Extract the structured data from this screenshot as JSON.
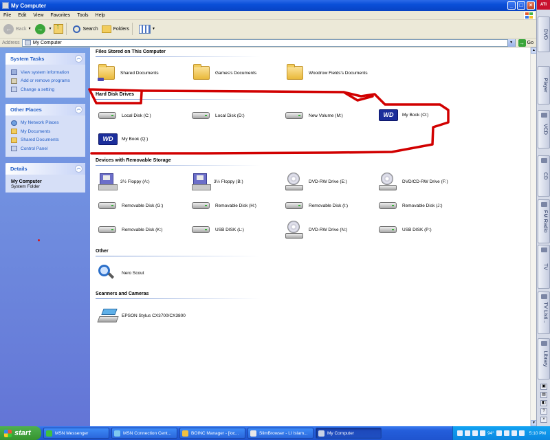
{
  "window": {
    "title": "My Computer"
  },
  "menu": [
    "File",
    "Edit",
    "View",
    "Favorites",
    "Tools",
    "Help"
  ],
  "toolbar": {
    "back": "Back",
    "search": "Search",
    "folders": "Folders"
  },
  "address": {
    "label": "Address",
    "value": "My Computer",
    "go": "Go"
  },
  "left": {
    "system_tasks": {
      "title": "System Tasks",
      "items": [
        "View system information",
        "Add or remove programs",
        "Change a setting"
      ]
    },
    "other_places": {
      "title": "Other Places",
      "items": [
        "My Network Places",
        "My Documents",
        "Shared Documents",
        "Control Panel"
      ]
    },
    "details": {
      "title": "Details",
      "name": "My Computer",
      "type": "System Folder"
    }
  },
  "groups": {
    "files": {
      "title": "Files Stored on This Computer",
      "items": [
        "Shared Documents",
        "Games's Documents",
        "Woodrow Fields's Documents"
      ]
    },
    "hdd": {
      "title": "Hard Disk Drives",
      "items": [
        "Local Disk (C:)",
        "Local Disk (D:)",
        "New Volume (M:)",
        "My Book (O:)",
        "My Book (Q:)"
      ]
    },
    "removable": {
      "title": "Devices with Removable Storage",
      "items": [
        "3½ Floppy (A:)",
        "3½ Floppy (B:)",
        "DVD-RW Drive (E:)",
        "DVD/CD-RW Drive (F:)",
        "Removable Disk (G:)",
        "Removable Disk (H:)",
        "Removable Disk (I:)",
        "Removable Disk (J:)",
        "Removable Disk (K:)",
        "USB DISK (L:)",
        "DVD-RW Drive (N:)",
        "USB DISK (P:)"
      ]
    },
    "other": {
      "title": "Other",
      "items": [
        "Nero Scout"
      ]
    },
    "scanners": {
      "title": "Scanners and Cameras",
      "items": [
        "EPSON Stylus CX3700/CX3800"
      ]
    }
  },
  "wd_logo": "WD",
  "media_bar": {
    "brand": "ATI",
    "tabs": [
      "DVD",
      "Player",
      "VCD",
      "CD",
      "FM Radio",
      "TV",
      "TV Listi...",
      "Library"
    ]
  },
  "taskbar": {
    "start": "start",
    "tasks": [
      "MSN Messenger",
      "MSN Connection Cent...",
      "BOINC Manager - [loc...",
      "SlimBrowser - LI Islam...",
      "My Computer"
    ],
    "temp": "94°",
    "clock": "5:10 PM"
  }
}
